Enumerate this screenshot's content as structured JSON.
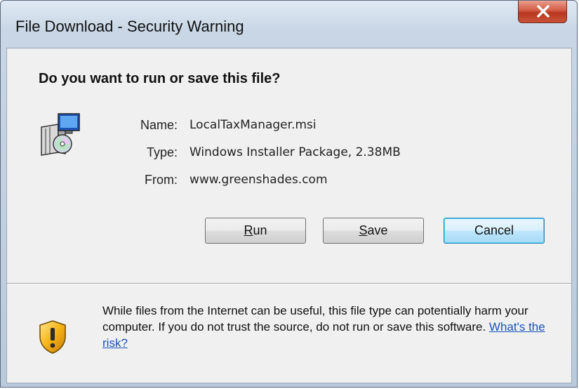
{
  "window": {
    "title": "File Download - Security Warning"
  },
  "dialog": {
    "question": "Do you want to run or save this file?",
    "file_info": [
      {
        "label": "Name:",
        "value": "LocalTaxManager.msi"
      },
      {
        "label": "Type:",
        "value": "Windows Installer Package, 2.38MB"
      },
      {
        "label": "From:",
        "value": "www.greenshades.com"
      }
    ],
    "buttons": {
      "run": {
        "mnemonic": "R",
        "rest": "un"
      },
      "save": {
        "mnemonic": "S",
        "rest": "ave"
      },
      "cancel": "Cancel"
    },
    "warning": {
      "text": "While files from the Internet can be useful, this file type can potentially harm your computer. If you do not trust the source, do not run or save this software.",
      "link": "What's the risk?"
    }
  },
  "icons": {
    "close": "close-icon",
    "installer": "installer-package-icon",
    "warning": "shield-warning-icon"
  },
  "colors": {
    "link": "#1a54b8",
    "default_button_border": "#3c7fb1",
    "close_button": "#c9533a"
  }
}
